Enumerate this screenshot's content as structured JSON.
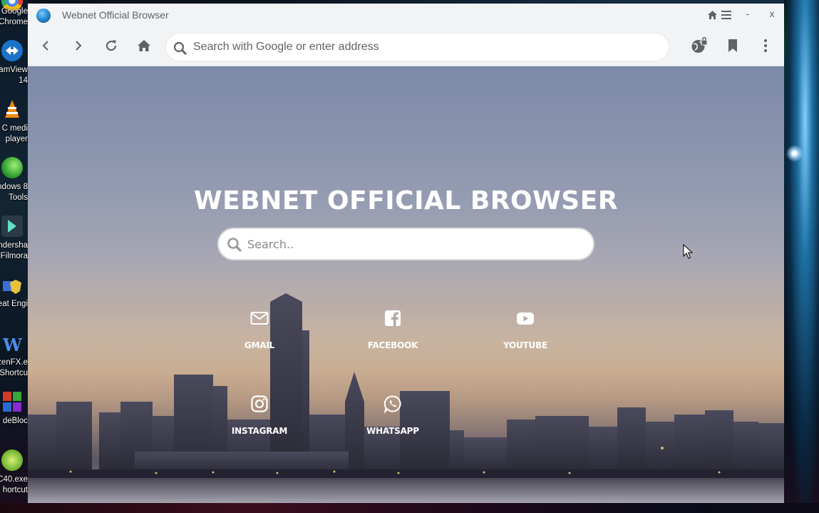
{
  "desktop": {
    "icons": [
      {
        "label_line1": "Google",
        "label_line2": "Chrome",
        "icon": "chrome-icon"
      },
      {
        "label_line1": "amView",
        "label_line2": "14",
        "icon": "teamviewer-icon"
      },
      {
        "label_line1": "C medi",
        "label_line2": "player",
        "icon": "vlc-icon"
      },
      {
        "label_line1": "ndows 8",
        "label_line2": "Tools",
        "icon": "windows-tools-icon"
      },
      {
        "label_line1": "ndersha",
        "label_line2": "Filmora",
        "icon": "filmora-icon"
      },
      {
        "label_line1": "eat Engi",
        "label_line2": "",
        "icon": "cheat-engine-icon"
      },
      {
        "label_line1": "zenFX.e",
        "label_line2": "Shortcu",
        "icon": "frozenfx-icon"
      },
      {
        "label_line1": "deBloc",
        "label_line2": "",
        "icon": "codeblocks-icon"
      },
      {
        "label_line1": "C40.exe",
        "label_line2": "hortcut",
        "icon": "c40-icon"
      }
    ]
  },
  "window": {
    "title": "Webnet Official Browser",
    "controls": {
      "minimize": "-",
      "close": "x"
    }
  },
  "toolbar": {
    "address_placeholder": "Search with Google or enter address"
  },
  "page": {
    "heading": "WEBNET OFFICIAL BROWSER",
    "search_placeholder": "Search..",
    "shortcuts": [
      {
        "label": "GMAIL",
        "icon": "envelope-icon"
      },
      {
        "label": "FACEBOOK",
        "icon": "facebook-icon"
      },
      {
        "label": "YOUTUBE",
        "icon": "youtube-icon"
      },
      {
        "label": "INSTAGRAM",
        "icon": "instagram-icon"
      },
      {
        "label": "WHATSAPP",
        "icon": "whatsapp-icon"
      }
    ]
  },
  "colors": {
    "accent": "#5f6368",
    "chrome_bg": "#f1f3f4",
    "text_white": "#ffffff"
  }
}
